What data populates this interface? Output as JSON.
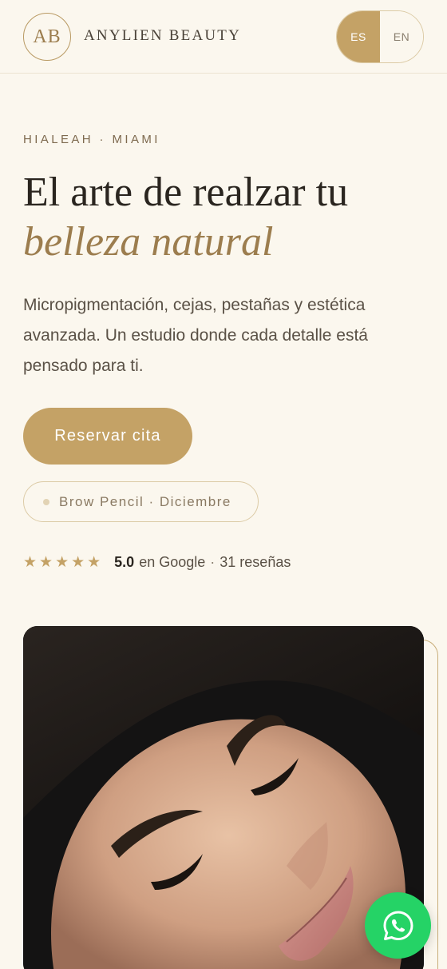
{
  "header": {
    "logo_initials": "AB",
    "brand_name": "ANYLIEN BEAUTY",
    "languages": [
      {
        "label": "ES",
        "active": true
      },
      {
        "label": "EN",
        "active": false
      }
    ]
  },
  "hero": {
    "eyebrow": "HIALEAH · MIAMI",
    "headline": "El arte de realzar tu",
    "headline_accent": "belleza natural",
    "intro": "Micropigmentación, cejas, pestañas y estética avanzada. Un estudio donde cada detalle está pensado para ti.",
    "cta_label": "Reservar cita",
    "promo": "Brow Pencil · Diciembre"
  },
  "rating": {
    "stars": "★★★★★",
    "score": "5.0",
    "source": "en Google",
    "separator": "·",
    "reviews": "31 reseñas"
  },
  "colors": {
    "accent": "#c4a266",
    "background": "#fbf7ee",
    "whatsapp": "#25d366"
  },
  "icons": {
    "floating_action": "whatsapp-icon"
  }
}
